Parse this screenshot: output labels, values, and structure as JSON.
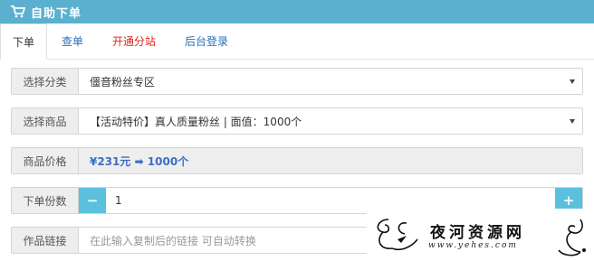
{
  "header": {
    "title": "自助下单",
    "icon": "cart-icon",
    "background": "#5bb0cf"
  },
  "tabs": [
    {
      "label": "下单",
      "active": true
    },
    {
      "label": "查单"
    },
    {
      "label": "开通分站",
      "color": "#d9281e"
    },
    {
      "label": "后台登录"
    }
  ],
  "form": {
    "category": {
      "label": "选择分类",
      "value": "僵音粉丝专区"
    },
    "product": {
      "label": "选择商品",
      "value": "【活动特价】真人质量粉丝 | 面值：1000个"
    },
    "price": {
      "label": "商品价格",
      "value": "¥231元 ➡ 1000个"
    },
    "quantity": {
      "label": "下单份数",
      "minus": "−",
      "value": "1",
      "plus": "+"
    },
    "link": {
      "label": "作品链接",
      "placeholder": "在此输入复制后的链接 可自动转换"
    }
  },
  "watermark": {
    "text": "夜河资源网",
    "sub": "www.yehes.com"
  }
}
